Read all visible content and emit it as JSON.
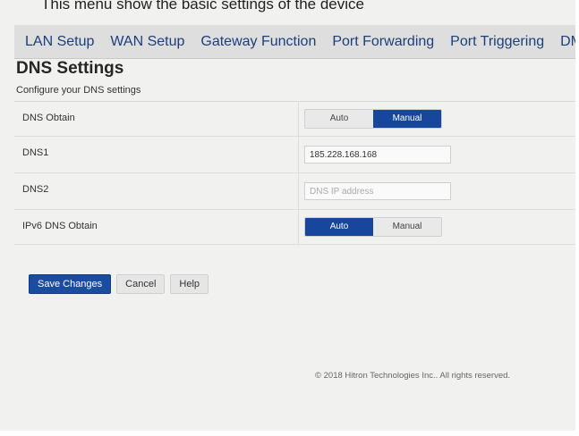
{
  "header": {
    "intro_text": "This menu show the basic settings of the device"
  },
  "tabs": [
    {
      "label": "LAN Setup"
    },
    {
      "label": "WAN Setup"
    },
    {
      "label": "Gateway Function"
    },
    {
      "label": "Port Forwarding"
    },
    {
      "label": "Port Triggering"
    },
    {
      "label": "DMZ"
    }
  ],
  "page": {
    "title": "DNS Settings",
    "subtitle": "Configure your DNS settings"
  },
  "settings": {
    "dns_obtain": {
      "label": "DNS Obtain",
      "options": [
        "Auto",
        "Manual"
      ],
      "selected": "Manual"
    },
    "dns1": {
      "label": "DNS1",
      "value": "185.228.168.168",
      "placeholder": ""
    },
    "dns2": {
      "label": "DNS2",
      "value": "",
      "placeholder": "DNS IP address"
    },
    "ipv6_dns_obtain": {
      "label": "IPv6 DNS Obtain",
      "options": [
        "Auto",
        "Manual"
      ],
      "selected": "Auto"
    }
  },
  "actions": {
    "save_label": "Save Changes",
    "cancel_label": "Cancel",
    "help_label": "Help"
  },
  "footer": {
    "copyright": "© 2018 Hitron Technologies Inc.. All rights reserved."
  },
  "colors": {
    "accent": "#17479c",
    "tab_text": "#1c3f79"
  }
}
